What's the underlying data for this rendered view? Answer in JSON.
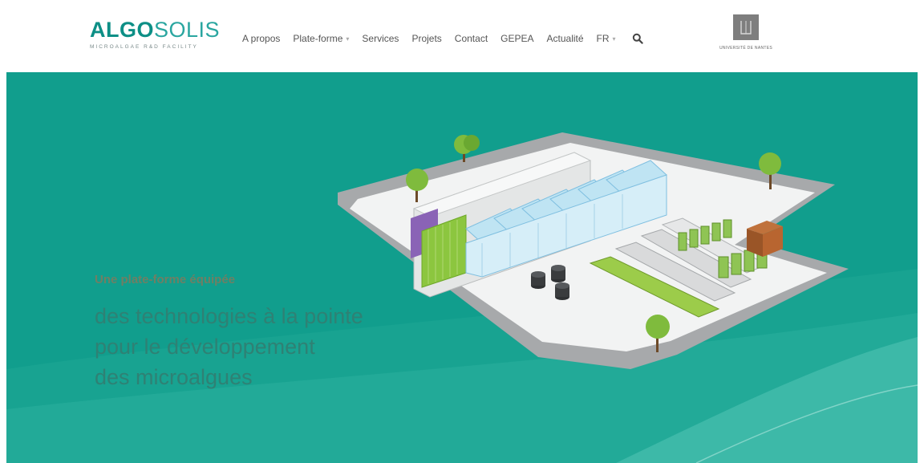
{
  "logo": {
    "word_part1": "ALGO",
    "word_part2": "SOLIS",
    "tagline": "MICROALGAE R&D FACILITY"
  },
  "nav": {
    "items": [
      {
        "label": "A propos"
      },
      {
        "label": "Plate-forme",
        "has_dropdown": true
      },
      {
        "label": "Services"
      },
      {
        "label": "Projets"
      },
      {
        "label": "Contact"
      },
      {
        "label": "GEPEA"
      },
      {
        "label": "Actualité"
      },
      {
        "label": "FR",
        "has_dropdown": true
      }
    ],
    "search_icon": "search-icon"
  },
  "university": {
    "name": "UNIVERSITÉ DE NANTES"
  },
  "hero": {
    "lead": "Une plate-forme équipée",
    "lines": [
      "des technologies à la pointe",
      "pour le développement",
      "des microalgues"
    ]
  },
  "colors": {
    "brand_dark": "#0d8f86",
    "brand_light": "#2aa6a0",
    "hero_bg": "#119e8d",
    "hero_text": "#2f8174",
    "lead_text": "#6f7f64"
  }
}
